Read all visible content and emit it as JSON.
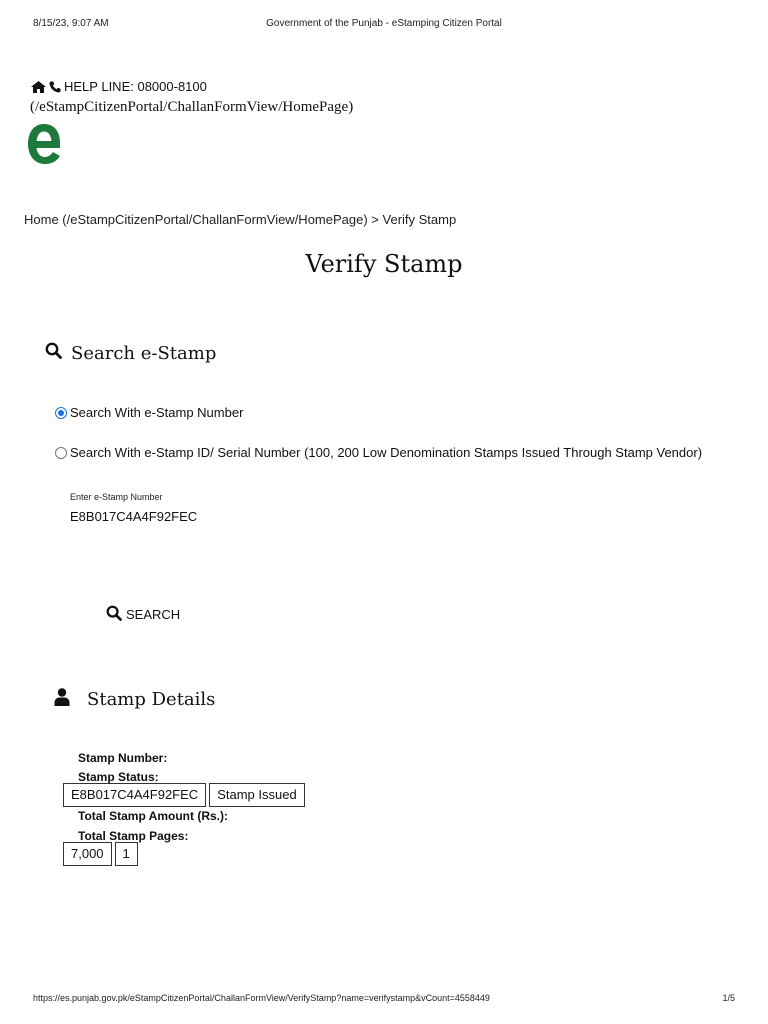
{
  "print_header": {
    "datetime": "8/15/23, 9:07 AM",
    "title": "Government of the Punjab - eStamping Citizen Portal"
  },
  "topbar": {
    "helpline": "HELP LINE: 08000-8100",
    "home_path": "(/eStampCitizenPortal/ChallanFormView/HomePage)",
    "icons": [
      "home-icon",
      "phone-icon"
    ]
  },
  "logo": {
    "letter": "e",
    "color": "#1e7a3c"
  },
  "breadcrumb": {
    "home": "Home (/eStampCitizenPortal/ChallanFormView/HomePage)",
    "separator": " > ",
    "current": "Verify Stamp"
  },
  "page_title": "Verify Stamp",
  "search": {
    "heading": "Search e-Stamp",
    "options": [
      {
        "label": "Search With e-Stamp Number",
        "selected": true
      },
      {
        "label": "Search With e-Stamp ID/ Serial Number (100, 200 Low Denomination Stamps Issued Through Stamp Vendor)",
        "selected": false
      }
    ],
    "field_label": "Enter e-Stamp Number",
    "field_value": "E8B017C4A4F92FEC",
    "button_label": "SEARCH"
  },
  "details": {
    "heading": "Stamp Details",
    "labels": {
      "stamp_number": "Stamp Number:",
      "stamp_status": "Stamp Status:",
      "total_amount": "Total Stamp Amount (Rs.):",
      "total_pages": "Total Stamp Pages:"
    },
    "values": {
      "stamp_number": "E8B017C4A4F92FEC",
      "stamp_status": "Stamp Issued",
      "total_amount": "7,000",
      "total_pages": "1"
    }
  },
  "print_footer": {
    "url": "https://es.punjab.gov.pk/eStampCitizenPortal/ChallanFormView/VerifyStamp?name=verifystamp&vCount=4558449",
    "page": "1/5"
  },
  "colors": {
    "radio_selected": "#1a73e8",
    "brand_green": "#1e7a3c"
  }
}
